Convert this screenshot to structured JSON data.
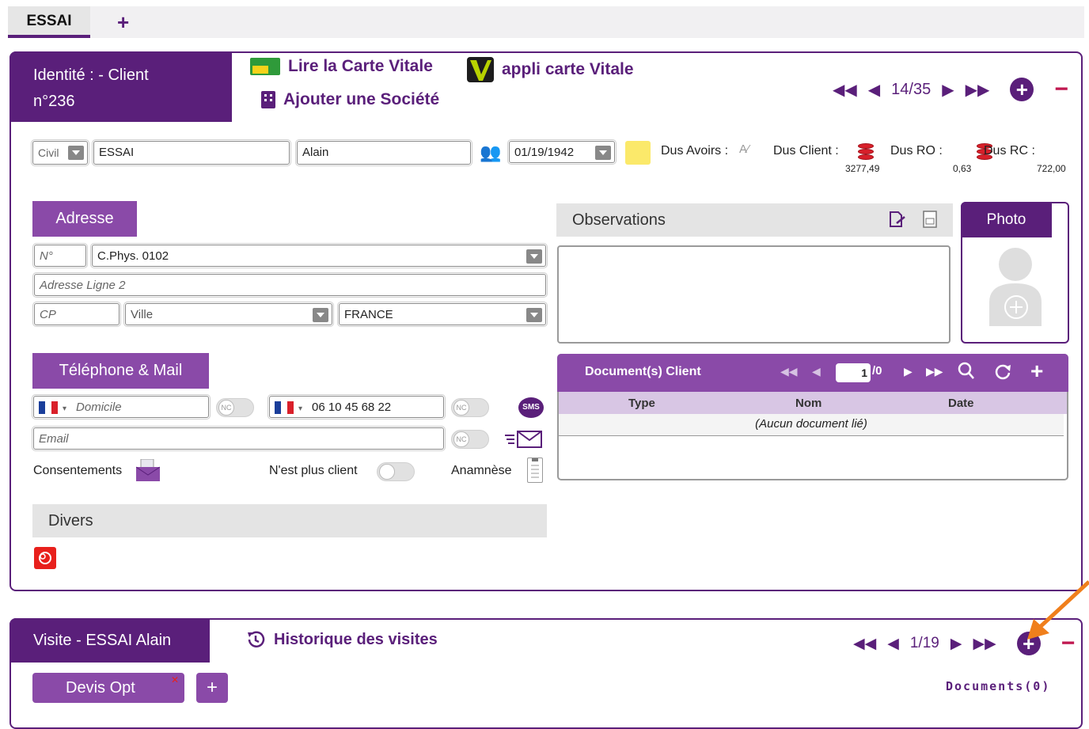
{
  "tabs": {
    "active": "ESSAI",
    "add": "+"
  },
  "identity": {
    "title_line1": "Identité : - Client",
    "title_line2": "n°236",
    "read_card": "Lire la Carte Vitale",
    "app_card": "appli carte Vitale",
    "add_company": "Ajouter une Société",
    "pager": "14/35",
    "civility_placeholder": "Civil",
    "last_name": "ESSAI",
    "first_name": "Alain",
    "birth_date": "01/19/1942",
    "dus_avoirs": "Dus Avoirs :",
    "dus_client": "Dus Client :",
    "dus_client_value": "3277,49",
    "dus_ro": "Dus RO :",
    "dus_ro_value": "0,63",
    "dus_rc": "Dus RC :",
    "dus_rc_value": "722,00"
  },
  "address": {
    "title": "Adresse",
    "number_placeholder": "N°",
    "line1": "C.Phys. 0102",
    "line2_placeholder": "Adresse Ligne 2",
    "cp_placeholder": "CP",
    "city_placeholder": "Ville",
    "country": "FRANCE"
  },
  "phone": {
    "title": "Téléphone & Mail",
    "home_placeholder": "Domicile",
    "mobile": "06 10 45 68 22",
    "email_placeholder": "Email",
    "nc": "NC",
    "sms": "SMS",
    "consents": "Consentements",
    "no_longer_client": "N'est plus client",
    "anamnesis": "Anamnèse"
  },
  "divers": {
    "title": "Divers"
  },
  "observations": {
    "title": "Observations"
  },
  "photo": {
    "title": "Photo"
  },
  "documents": {
    "title": "Document(s) Client",
    "page": "1",
    "total": "/0",
    "columns": [
      "Type",
      "Nom",
      "Date"
    ],
    "empty": "(Aucun document lié)"
  },
  "visite": {
    "title": "Visite - ESSAI Alain",
    "history": "Historique des visites",
    "pager": "1/19",
    "devis_tab": "Devis Opt",
    "documents": "Documents(0)"
  },
  "colors": {
    "primary": "#5a1f7a",
    "secondary": "#8a4aa8",
    "danger": "#c0174f",
    "annotation": "#f07f1c"
  }
}
